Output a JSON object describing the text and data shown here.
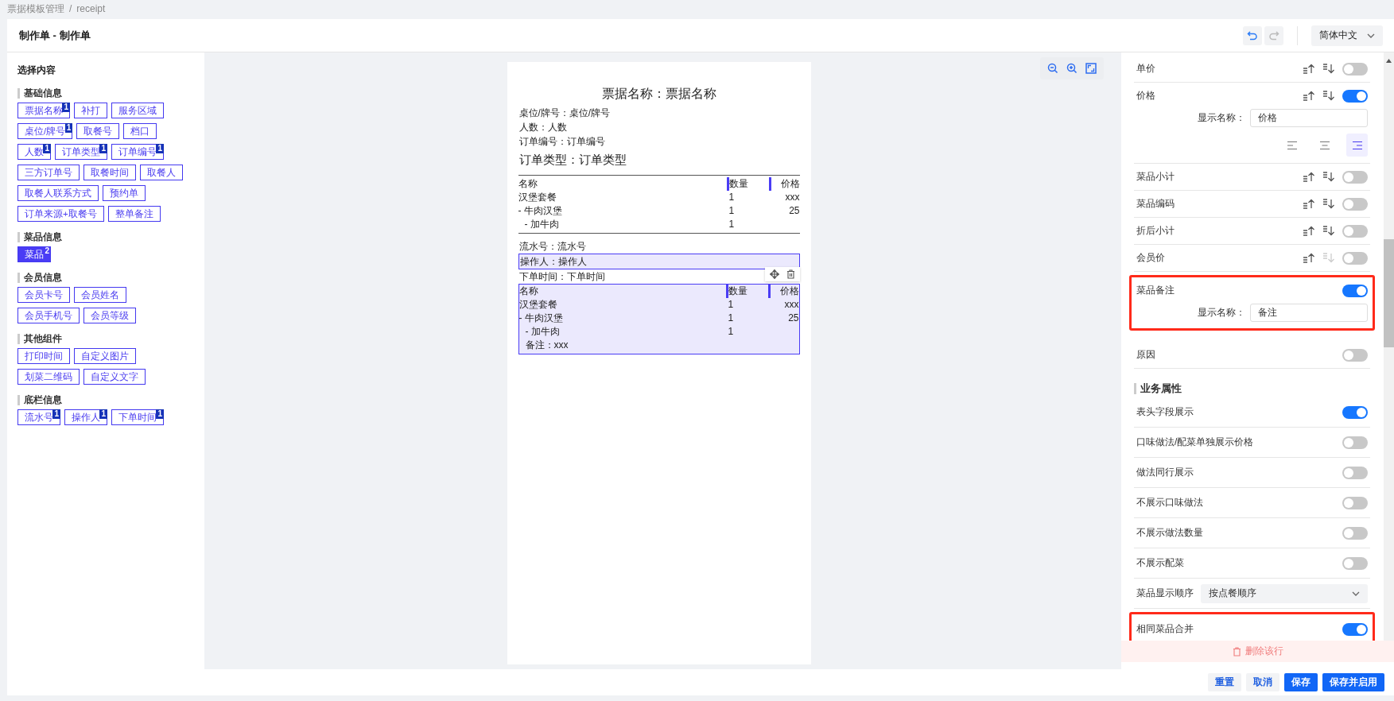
{
  "breadcrumb": [
    "票据模板管理",
    "/",
    "receipt"
  ],
  "header": {
    "title": "制作单 - 制作单",
    "undo": {
      "disabled": false
    },
    "redo": {
      "disabled": true
    },
    "language": "简体中文"
  },
  "palette": {
    "title": "选择内容",
    "groups": [
      {
        "title": "基础信息",
        "items": [
          {
            "label": "票据名称",
            "count": "1",
            "selected": false
          },
          {
            "label": "补打",
            "selected": false
          },
          {
            "label": "服务区域",
            "selected": false
          },
          {
            "label": "桌位/牌号",
            "count": "1",
            "selected": false
          },
          {
            "label": "取餐号",
            "selected": false
          },
          {
            "label": "档口",
            "selected": false
          },
          {
            "label": "人数",
            "count": "1",
            "selected": false
          },
          {
            "label": "订单类型",
            "count": "1",
            "selected": false
          },
          {
            "label": "订单编号",
            "count": "1",
            "selected": false
          },
          {
            "label": "三方订单号",
            "selected": false
          },
          {
            "label": "取餐时间",
            "selected": false
          },
          {
            "label": "取餐人",
            "selected": false
          },
          {
            "label": "取餐人联系方式",
            "selected": false
          },
          {
            "label": "预约单",
            "selected": false
          },
          {
            "label": "订单来源+取餐号",
            "selected": false
          },
          {
            "label": "整单备注",
            "selected": false
          }
        ]
      },
      {
        "title": "菜品信息",
        "items": [
          {
            "label": "菜品",
            "count": "2",
            "selected": true
          }
        ]
      },
      {
        "title": "会员信息",
        "items": [
          {
            "label": "会员卡号",
            "selected": false
          },
          {
            "label": "会员姓名",
            "selected": false
          },
          {
            "label": "会员手机号",
            "selected": false
          },
          {
            "label": "会员等级",
            "selected": false
          }
        ]
      },
      {
        "title": "其他组件",
        "items": [
          {
            "label": "打印时间",
            "selected": false
          },
          {
            "label": "自定义图片",
            "selected": false
          },
          {
            "label": "划菜二维码",
            "selected": false
          },
          {
            "label": "自定义文字",
            "selected": false
          }
        ]
      },
      {
        "title": "底栏信息",
        "items": [
          {
            "label": "流水号",
            "count": "1",
            "selected": false
          },
          {
            "label": "操作人",
            "count": "1",
            "selected": false
          },
          {
            "label": "下单时间",
            "count": "1",
            "selected": false
          }
        ]
      }
    ]
  },
  "receipt": {
    "blocks": [
      {
        "kind": "title",
        "text": "票据名称：票据名称",
        "selected": false
      },
      {
        "kind": "line",
        "text": "桌位/牌号：桌位/牌号",
        "selected": false
      },
      {
        "kind": "line",
        "text": "人数：人数",
        "selected": false
      },
      {
        "kind": "line",
        "text": "订单编号：订单编号",
        "selected": false
      },
      {
        "kind": "large",
        "text": "订单类型：订单类型",
        "selected": false
      },
      {
        "kind": "table",
        "selected": false,
        "columns": [
          "名称",
          "数量",
          "价格"
        ],
        "rows": [
          {
            "name": "汉堡套餐",
            "qty": "1",
            "price": "xxx",
            "children": [
              {
                "name": "- 牛肉汉堡",
                "qty": "1",
                "price": "25",
                "children": [
                  {
                    "name": "- 加牛肉",
                    "qty": "1"
                  }
                ]
              }
            ]
          }
        ]
      },
      {
        "kind": "line",
        "text": "流水号：流水号",
        "selected": false
      },
      {
        "kind": "line",
        "text": "操作人：操作人",
        "selected": true
      },
      {
        "kind": "line",
        "text": "下单时间：下单时间",
        "selected": false
      },
      {
        "kind": "table",
        "selected": true,
        "columns": [
          "名称",
          "数量",
          "价格"
        ],
        "rows": [
          {
            "name": "汉堡套餐",
            "qty": "1",
            "price": "xxx",
            "children": [
              {
                "name": "- 牛肉汉堡",
                "qty": "1",
                "price": "25",
                "children": [
                  {
                    "name": "- 加牛肉",
                    "qty": "1"
                  }
                ]
              }
            ]
          }
        ],
        "note": "备注：xxx"
      }
    ]
  },
  "settings": {
    "fields": [
      {
        "kind": "toggle",
        "label": "单价",
        "sort": {
          "asc_disabled": false,
          "desc_disabled": false
        },
        "on": false,
        "highlighted": false
      },
      {
        "kind": "toggle",
        "label": "价格",
        "sort": {
          "asc_disabled": false,
          "desc_disabled": false
        },
        "on": true,
        "highlighted": false,
        "display_label": "显示名称：",
        "display_value": "价格",
        "alignment": [
          {
            "kind": "left",
            "selected": false
          },
          {
            "kind": "center",
            "selected": false
          },
          {
            "kind": "right",
            "selected": true
          }
        ]
      },
      {
        "kind": "toggle",
        "label": "菜品小计",
        "sort": {
          "asc_disabled": false,
          "desc_disabled": false
        },
        "on": false,
        "highlighted": false
      },
      {
        "kind": "toggle",
        "label": "菜品编码",
        "sort": {
          "asc_disabled": false,
          "desc_disabled": false
        },
        "on": false,
        "highlighted": false
      },
      {
        "kind": "toggle",
        "label": "折后小计",
        "sort": {
          "asc_disabled": false,
          "desc_disabled": false
        },
        "on": false,
        "highlighted": false
      },
      {
        "kind": "toggle",
        "label": "会员价",
        "sort": {
          "asc_disabled": false,
          "desc_disabled": true
        },
        "on": false,
        "highlighted": false
      },
      {
        "kind": "toggle",
        "label": "菜品备注",
        "on": true,
        "highlighted": true,
        "display_label": "显示名称：",
        "display_value": "备注"
      },
      {
        "kind": "toggle",
        "label": "原因",
        "on": false,
        "highlighted": false
      }
    ],
    "business_title": "业务属性",
    "business": [
      {
        "kind": "toggle",
        "label": "表头字段展示",
        "on": true,
        "highlighted": false
      },
      {
        "kind": "toggle",
        "label": "口味做法/配菜单独展示价格",
        "on": false,
        "highlighted": false
      },
      {
        "kind": "toggle",
        "label": "做法同行展示",
        "on": false,
        "highlighted": false
      },
      {
        "kind": "toggle",
        "label": "不展示口味做法",
        "on": false,
        "highlighted": false
      },
      {
        "kind": "toggle",
        "label": "不展示做法数量",
        "on": false,
        "highlighted": false
      },
      {
        "kind": "toggle",
        "label": "不展示配菜",
        "on": false,
        "highlighted": false
      },
      {
        "kind": "select",
        "label": "菜品显示顺序",
        "value": "按点餐顺序",
        "highlighted": false
      },
      {
        "kind": "toggle",
        "label": "相同菜品合并",
        "on": true,
        "highlighted": true
      }
    ],
    "delete_label": "删除该行"
  },
  "footer": [
    {
      "label": "重置",
      "kind": "secondary"
    },
    {
      "label": "取消",
      "kind": "secondary"
    },
    {
      "label": "保存",
      "kind": "primary"
    },
    {
      "label": "保存并启用",
      "kind": "primary"
    }
  ]
}
